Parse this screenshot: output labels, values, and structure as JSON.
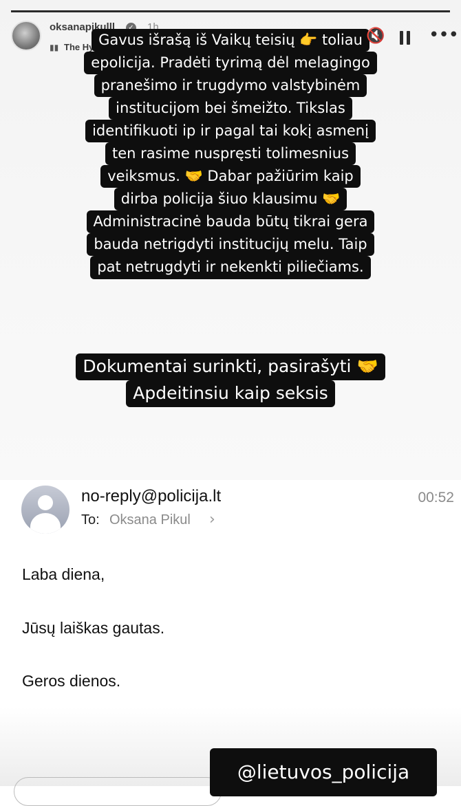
{
  "story": {
    "username": "oksanapikulll",
    "verified_icon": "verified-badge-icon",
    "time": "1h",
    "music": "The Hyphenate, Judo Keys · Punisher",
    "music_icon": "music-bars-icon",
    "controls": [
      "mute-icon",
      "pause-icon",
      "more-icon"
    ],
    "progress": 1.0
  },
  "caption1": {
    "lines": [
      "Gavus išrašą iš Vaikų teisių 👉 toliau",
      "epolicija. Pradėti tyrimą dėl melagingo",
      "pranešimo ir trugdymo valstybinėm",
      "institucijom bei šmeižto. Tikslas",
      "identifikuoti ip ir pagal tai kokį asmenį",
      "ten rasime nuspręsti tolimesnius",
      "veiksmus. 🤝 Dabar pažiūrim kaip",
      "dirba policija šiuo klausimu 🤝",
      "Administracinė bauda būtų tikrai gera",
      "bauda netrigdyti institucijų melu. Taip",
      "pat netrugdyti ir nekenkti piliečiams."
    ]
  },
  "caption2": {
    "lines": [
      "Dokumentai surinkti, pasirašyti 🤝",
      "Apdeitinsiu kaip seksis"
    ]
  },
  "email": {
    "sender": "no-reply@policija.lt",
    "time": "00:52",
    "to_label": "To:",
    "to_name": "Oksana Pikul",
    "body": [
      "Laba diena,",
      "Jūsų laiškas gautas.",
      "Geros dienos."
    ]
  },
  "mention": "@lietuvos_policija"
}
